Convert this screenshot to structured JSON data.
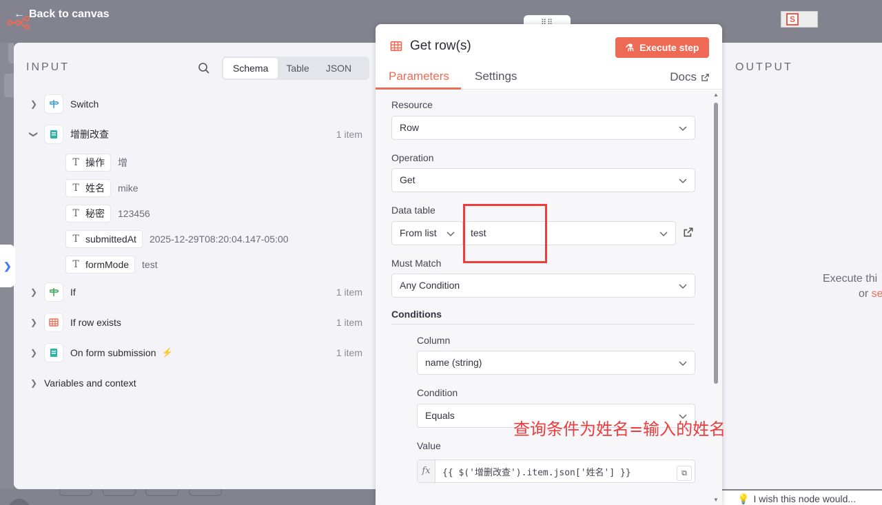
{
  "topbar": {
    "back_label": "Back to canvas"
  },
  "input": {
    "panel_label": "INPUT",
    "tabs": [
      "Schema",
      "Table",
      "JSON"
    ],
    "active_tab": "Schema",
    "nodes": [
      {
        "name": "Switch",
        "count": "",
        "expanded": false,
        "icon": "switch-icon",
        "color": "#3a9ad9"
      },
      {
        "name": "增删改查",
        "count": "1 item",
        "expanded": true,
        "icon": "form-icon",
        "color": "#2ab5a5",
        "fields": [
          {
            "key": "操作",
            "value": "增"
          },
          {
            "key": "姓名",
            "value": "mike"
          },
          {
            "key": "秘密",
            "value": "123456"
          },
          {
            "key": "submittedAt",
            "value": "2025-12-29T08:20:04.147-05:00"
          },
          {
            "key": "formMode",
            "value": "test"
          }
        ]
      },
      {
        "name": "If",
        "count": "1 item",
        "expanded": false,
        "icon": "if-icon",
        "color": "#3aa55a"
      },
      {
        "name": "If row exists",
        "count": "1 item",
        "expanded": false,
        "icon": "table-icon",
        "color": "#ee6a55"
      },
      {
        "name": "On form submission",
        "count": "1 item",
        "expanded": false,
        "icon": "form-icon",
        "color": "#2ab5a5",
        "trigger": true
      }
    ],
    "variables_label": "Variables and context"
  },
  "ndv": {
    "handle": "⠿⠿",
    "title": "Get row(s)",
    "execute_label": "Execute step",
    "tabs": {
      "parameters": "Parameters",
      "settings": "Settings",
      "docs": "Docs"
    },
    "resource": {
      "label": "Resource",
      "value": "Row"
    },
    "operation": {
      "label": "Operation",
      "value": "Get"
    },
    "data_table": {
      "label": "Data table",
      "mode": "From list",
      "value": "test"
    },
    "must_match": {
      "label": "Must Match",
      "value": "Any Condition"
    },
    "conditions_label": "Conditions",
    "column": {
      "label": "Column",
      "value": "name (string)"
    },
    "condition": {
      "label": "Condition",
      "value": "Equals"
    },
    "value_field": {
      "label": "Value",
      "fx": "fx",
      "expression": "{{ $('增删改查').item.json['姓名'] }}"
    },
    "annotation": "查询条件为姓名=输入的姓名",
    "accent": "#ee6a55"
  },
  "output": {
    "panel_label": "OUTPUT",
    "hint_line1": "Execute thi",
    "hint_line2_prefix": "or ",
    "hint_line2_link": "se"
  },
  "feedback": {
    "label": "I wish this node would..."
  }
}
